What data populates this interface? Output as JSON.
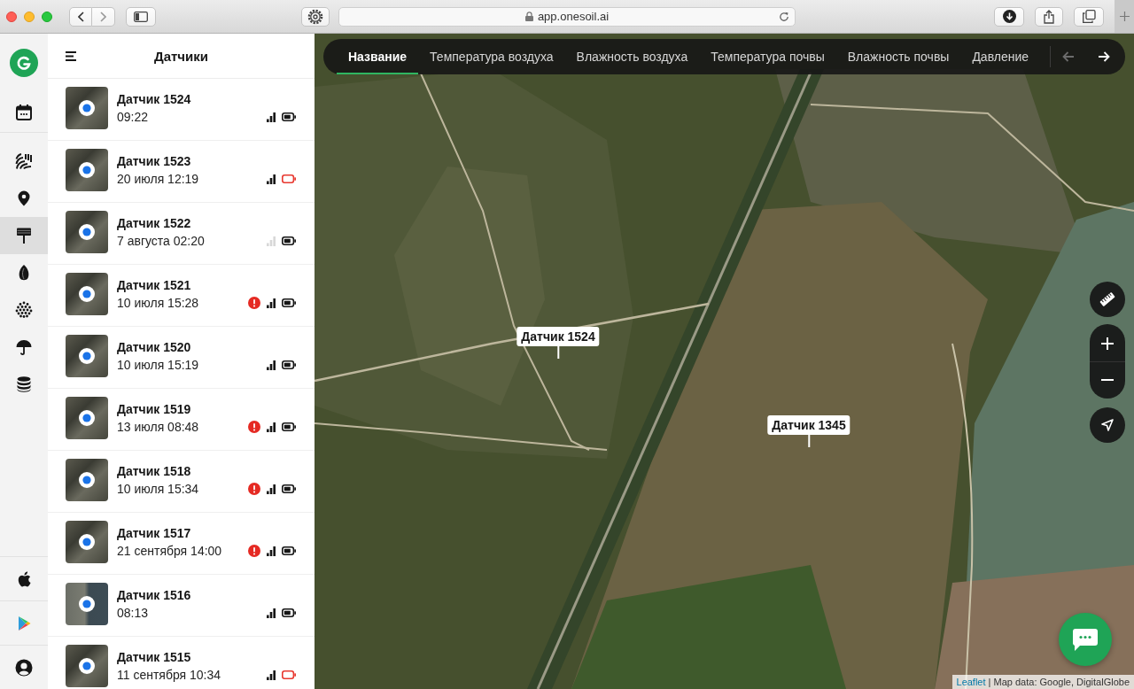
{
  "browser": {
    "url": "app.onesoil.ai"
  },
  "rail": {
    "items": [
      {
        "selected": false
      },
      {
        "selected": false
      },
      {
        "selected": false
      },
      {
        "selected": true
      },
      {
        "selected": false
      },
      {
        "selected": false
      },
      {
        "selected": false
      },
      {
        "selected": false
      }
    ]
  },
  "sidebar": {
    "title": "Датчики",
    "sensors": [
      {
        "name": "Датчик 1524",
        "time": "09:22",
        "alert": false,
        "signal_lost": false,
        "battery_low": false
      },
      {
        "name": "Датчик 1523",
        "time": "20 июля 12:19",
        "alert": false,
        "signal_lost": false,
        "battery_low": true
      },
      {
        "name": "Датчик 1522",
        "time": "7 августа 02:20",
        "alert": false,
        "signal_lost": true,
        "battery_low": false
      },
      {
        "name": "Датчик 1521",
        "time": "10 июля 15:28",
        "alert": true,
        "signal_lost": false,
        "battery_low": false
      },
      {
        "name": "Датчик 1520",
        "time": "10 июля 15:19",
        "alert": false,
        "signal_lost": false,
        "battery_low": false
      },
      {
        "name": "Датчик 1519",
        "time": "13 июля 08:48",
        "alert": true,
        "signal_lost": false,
        "battery_low": false
      },
      {
        "name": "Датчик 1518",
        "time": "10 июля 15:34",
        "alert": true,
        "signal_lost": false,
        "battery_low": false
      },
      {
        "name": "Датчик 1517",
        "time": "21 сентября 14:00",
        "alert": true,
        "signal_lost": false,
        "battery_low": false
      },
      {
        "name": "Датчик 1516",
        "time": "08:13",
        "alert": false,
        "signal_lost": false,
        "battery_low": false
      },
      {
        "name": "Датчик 1515",
        "time": "11 сентября 10:34",
        "alert": false,
        "signal_lost": false,
        "battery_low": true
      }
    ]
  },
  "map": {
    "tabs": [
      {
        "label": "Название",
        "selected": true
      },
      {
        "label": "Температура воздуха",
        "selected": false
      },
      {
        "label": "Влажность воздуха",
        "selected": false
      },
      {
        "label": "Температура почвы",
        "selected": false
      },
      {
        "label": "Влажность почвы",
        "selected": false
      },
      {
        "label": "Давление",
        "selected": false
      }
    ],
    "tab_arrows": [
      {
        "disabled": true
      },
      {
        "disabled": false
      }
    ],
    "markers": [
      {
        "label": "Датчик 1524"
      },
      {
        "label": "Датчик 1345"
      }
    ],
    "attribution": {
      "link": "Leaflet",
      "text": "| Map data: Google, DigitalGlobe"
    }
  }
}
